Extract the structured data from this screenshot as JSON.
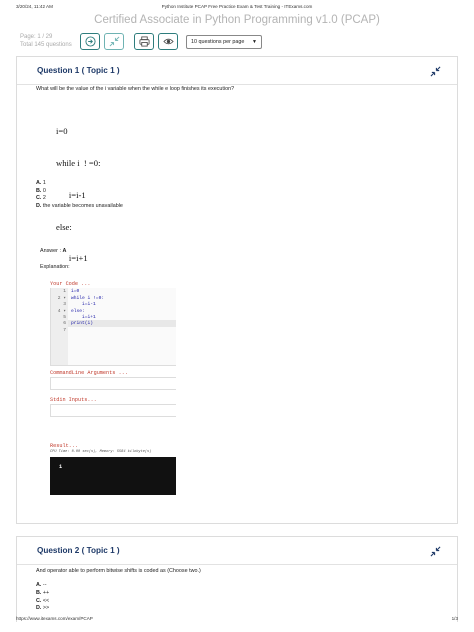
{
  "print_header": {
    "datetime": "3/20/24, 11:42 AM",
    "doc_title": "Python Institute PCAP Free Practice Exam & Test Training - ITExams.com"
  },
  "page_title": "Certified Associate in Python Programming v1.0 (PCAP)",
  "pager": {
    "page": "Page:   1 / 29",
    "total": "Total 145 questions"
  },
  "toolbar": {
    "buttons": [
      "arrow-right-circle-icon",
      "collapse-arrows-icon",
      "printer-icon",
      "eye-icon"
    ],
    "per_page": "10 questions per page",
    "accent": "#2e7d7d"
  },
  "question1": {
    "title": "Question 1 ( Topic 1 )",
    "text": "What will be the value of the i variable when the while e loop finishes its execution?",
    "code_lines": [
      "i=0",
      "while i  ! =0:",
      "      i=i-1",
      "else:",
      "      i=i+1"
    ],
    "options": [
      {
        "letter": "A.",
        "text": "1"
      },
      {
        "letter": "B.",
        "text": "0"
      },
      {
        "letter": "C.",
        "text": "2"
      },
      {
        "letter": "D.",
        "text": "the variable becomes unavailable"
      }
    ],
    "answer_label": "Answer :",
    "answer_value": "A",
    "explanation_label": "Explanation:"
  },
  "ide": {
    "code_label": "Your Code ...",
    "line_numbers": [
      "1",
      "2 ▾",
      "3",
      "4 ▾",
      "5",
      "6",
      "7"
    ],
    "lines": [
      "i=0",
      "while i !=0:",
      "    i=i-1",
      "else:",
      "    i=i+1",
      "print(i)",
      ""
    ],
    "cmd_label": "CommandLine Arguments ...",
    "stdin_label": "Stdin Inputs...",
    "result_label": "Result...",
    "result_meta": "CPU Time: 0.00 sec(s), Memory: 5584 kilobyte(s)",
    "result_output": "1"
  },
  "question2": {
    "title": "Question 2 ( Topic 1 )",
    "text": "And operator able to perform bitwise shifts is coded as (Choose two.)",
    "options": [
      {
        "letter": "A.",
        "text": "--"
      },
      {
        "letter": "B.",
        "text": "++"
      },
      {
        "letter": "C.",
        "text": "<<"
      },
      {
        "letter": "D.",
        "text": ">>"
      }
    ]
  },
  "print_footer": {
    "url": "https://www.itexams.com/exam/PCAP",
    "page": "1/3"
  }
}
